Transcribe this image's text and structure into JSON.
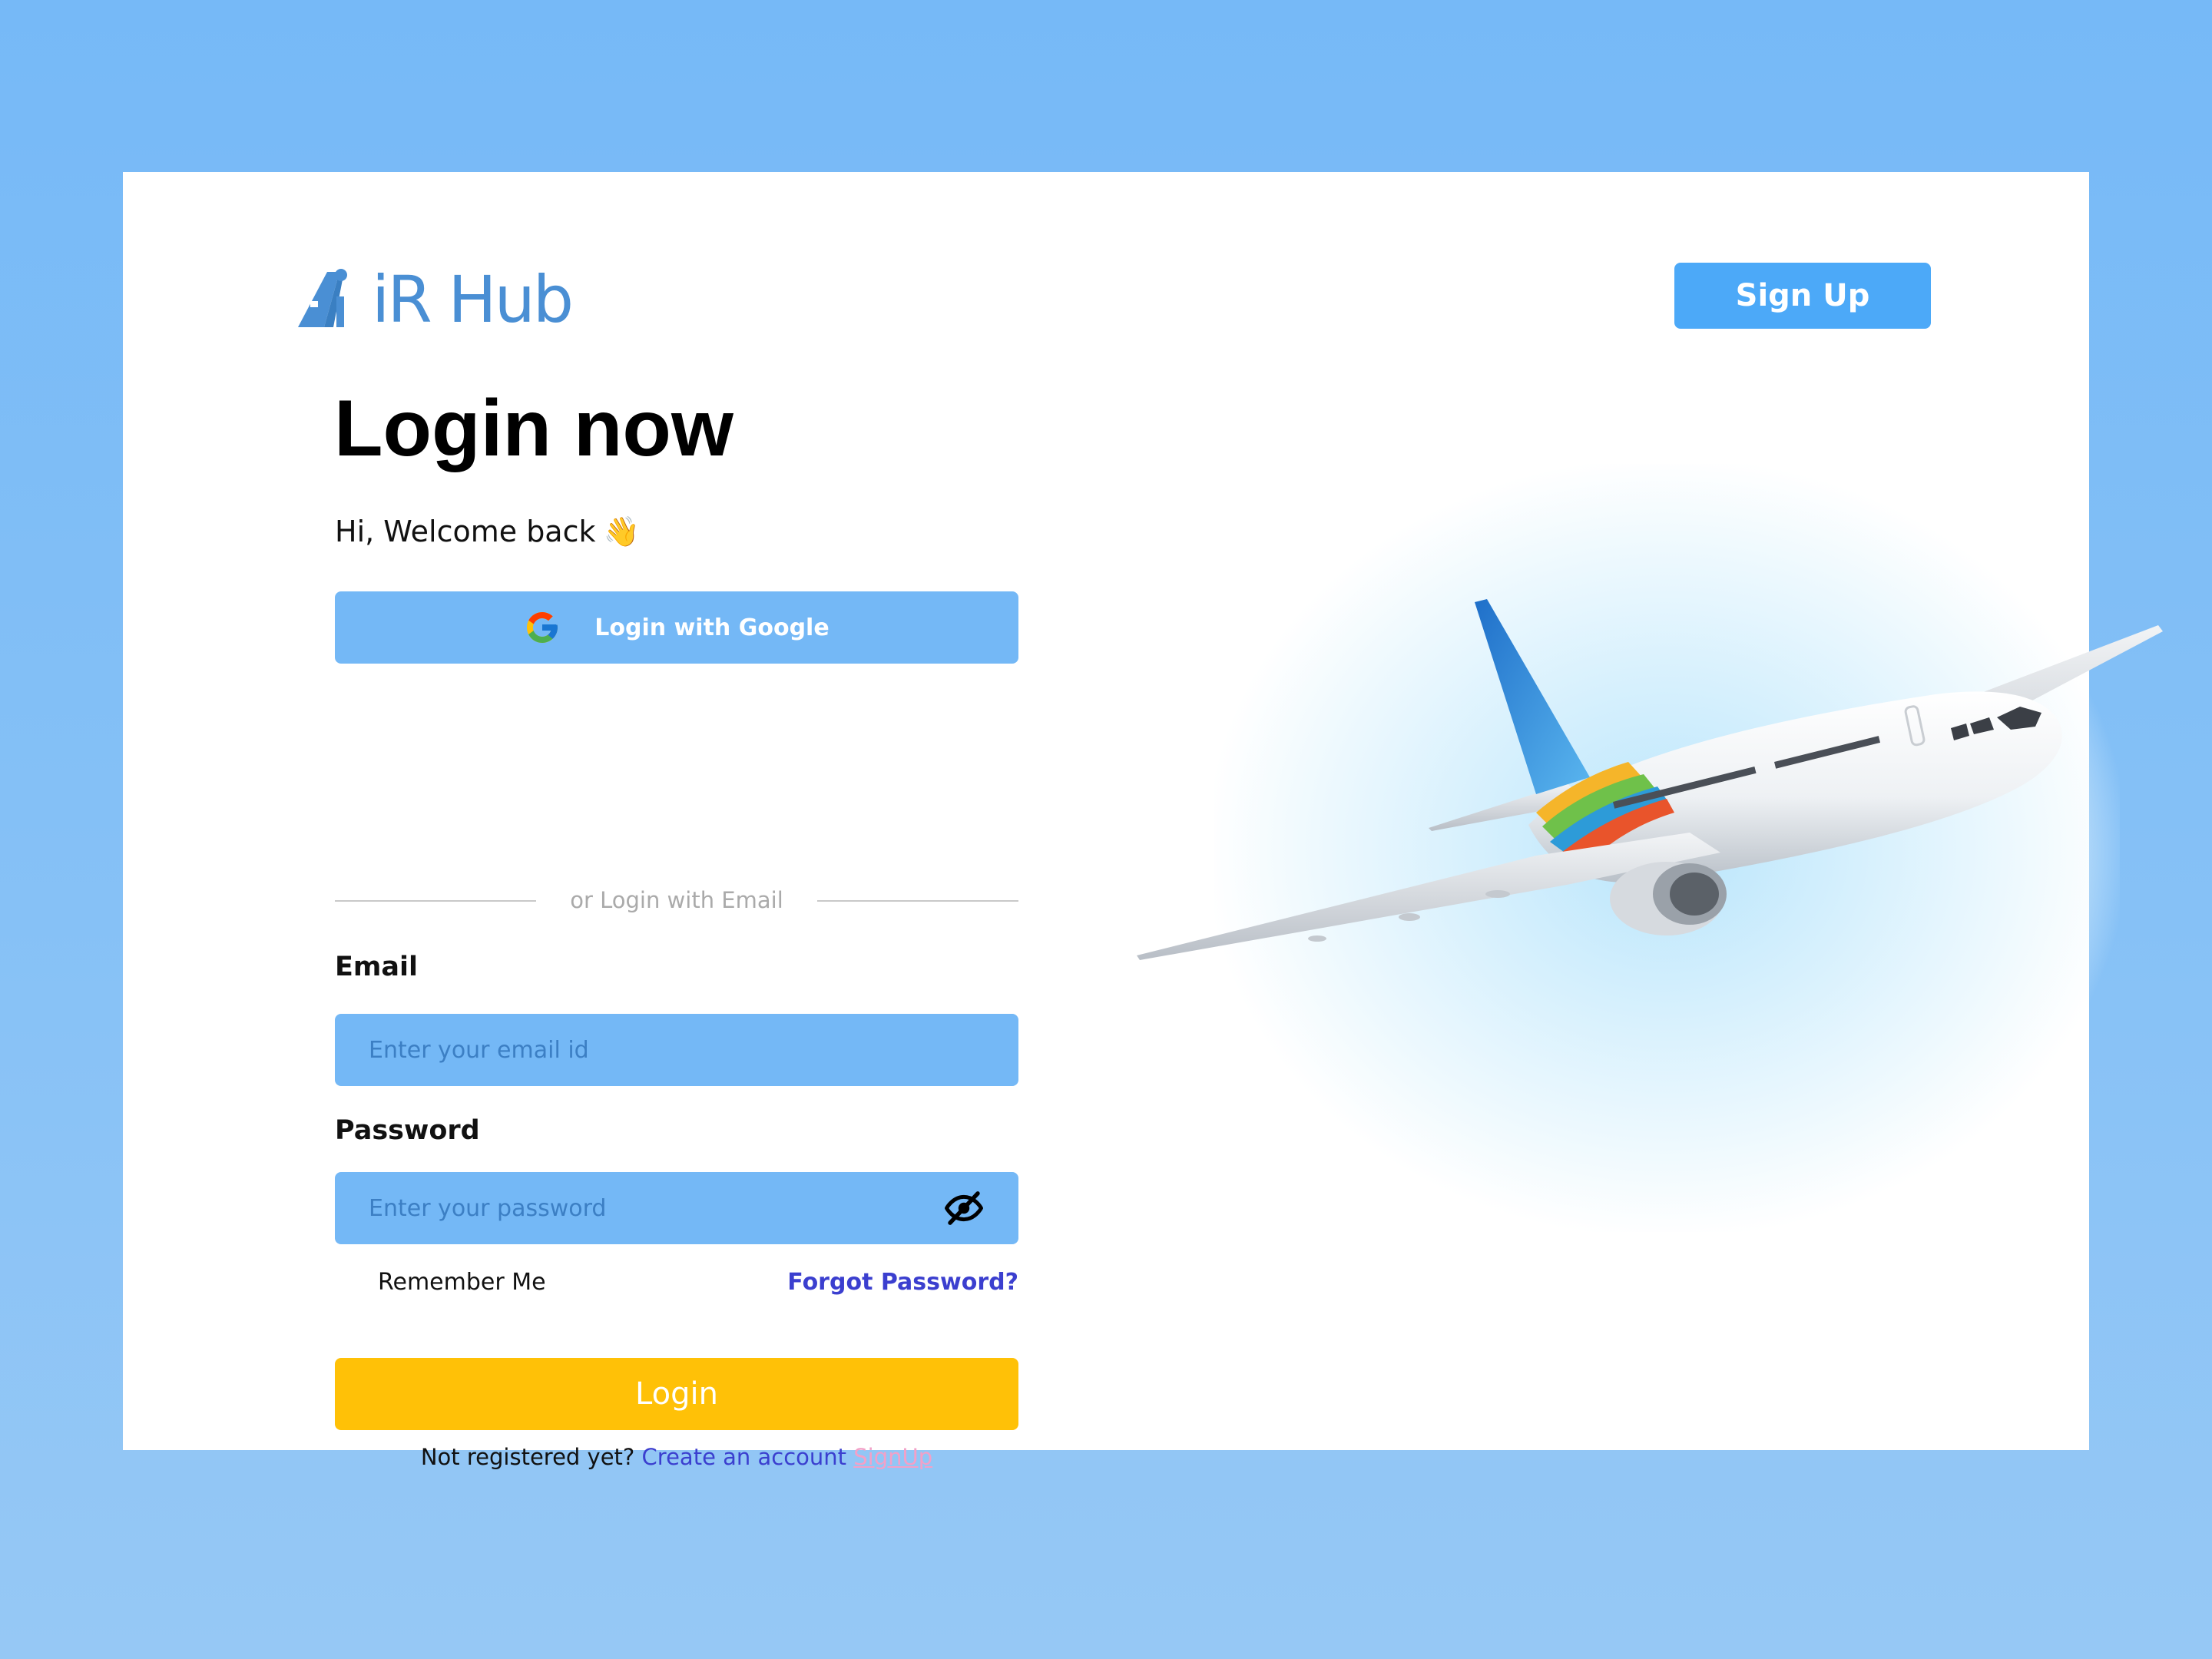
{
  "brand": {
    "logo_text": "iR Hub",
    "name": "AiR Hub"
  },
  "header": {
    "signup_label": "Sign Up"
  },
  "login": {
    "title": "Login now",
    "welcome": "Hi, Welcome back",
    "wave_emoji": "👋",
    "google_label": "Login with Google",
    "divider_text": "or Login with Email",
    "email_label": "Email",
    "email_placeholder": "Enter your email id",
    "email_value": "",
    "password_label": "Password",
    "password_placeholder": "Enter your password",
    "password_value": "",
    "remember_label": "Remember Me",
    "forgot_label": "Forgot Password?",
    "submit_label": "Login",
    "footer_question": "Not registered yet?",
    "footer_create": "Create an account",
    "footer_signup": "SignUp"
  },
  "icons": {
    "google": "google-icon",
    "password_toggle": "eye-off-icon",
    "wave": "waving-hand-icon",
    "hero": "airplane-illustration"
  },
  "colors": {
    "page_background": "#76b9f7",
    "card_background": "#ffffff",
    "field_background": "#74b8f6",
    "primary_button": "#4ca9f8",
    "login_button": "#ffc107",
    "link": "#3b3fcf",
    "signup_link": "#f2a1c8",
    "logo": "#4a8fd4"
  }
}
